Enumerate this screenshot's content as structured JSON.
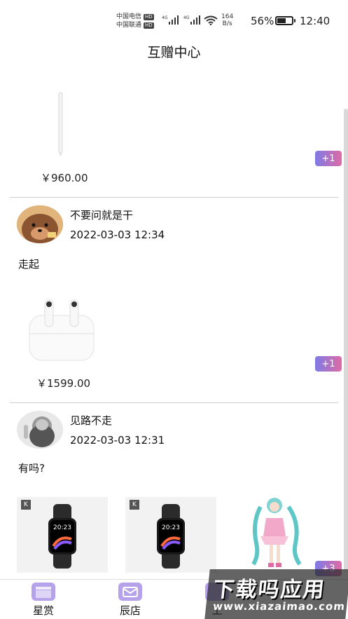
{
  "status_bar": {
    "carrier1": "中国电信",
    "carrier2": "中国联通",
    "hd": "HD",
    "net": "4G",
    "speed_value": "164",
    "speed_unit": "B/s",
    "battery": "56%",
    "battery_level": 0.56,
    "time": "12:40"
  },
  "header": {
    "title": "互赠中心"
  },
  "posts": [
    {
      "price": "￥960.00",
      "plus": "+1"
    },
    {
      "username": "不要问就是干",
      "time": "2022-03-03 12:34",
      "text": "走起",
      "price": "￥1599.00",
      "plus": "+1"
    },
    {
      "username": "见路不走",
      "time": "2022-03-03 12:31",
      "text": "有吗?",
      "plus": "+3",
      "watch_time": "20:23",
      "watch_tag": "K"
    }
  ],
  "bottom_nav": [
    {
      "label": "星赏"
    },
    {
      "label": "辰店"
    },
    {
      "label": "工"
    }
  ],
  "watermark": {
    "main": "下载吗应用",
    "sub": "www.xiazaimao.com"
  }
}
